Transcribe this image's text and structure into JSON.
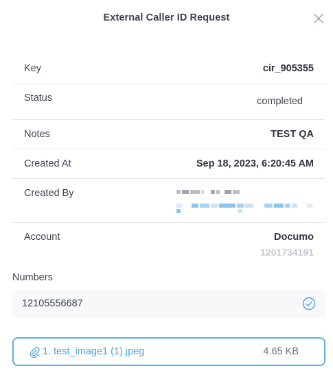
{
  "modal": {
    "title": "External Caller ID Request",
    "close_icon": "close-icon"
  },
  "details": [
    {
      "label": "Key",
      "value": "cir_905355"
    },
    {
      "label": "Status",
      "value": "completed"
    },
    {
      "label": "Notes",
      "value": "TEST QA"
    },
    {
      "label": "Created At",
      "value": "Sep 18, 2023, 6:20:45 AM"
    },
    {
      "label": "Created By",
      "value": ""
    },
    {
      "label": "Account",
      "value": "Documo",
      "sub": "1201734191"
    }
  ],
  "numbers": {
    "section_label": "Numbers",
    "items": [
      {
        "number": "12105556687",
        "status_icon": "check-circle-icon"
      }
    ]
  },
  "attachments": [
    {
      "name": "1. test_image1 (1).jpeg",
      "size": "4.65 KB",
      "icon": "paperclip-icon"
    }
  ],
  "colors": {
    "accent": "#4aa3df",
    "border": "#5aaee7",
    "divider": "#e3e5ea",
    "muted": "#c4c9d2"
  }
}
